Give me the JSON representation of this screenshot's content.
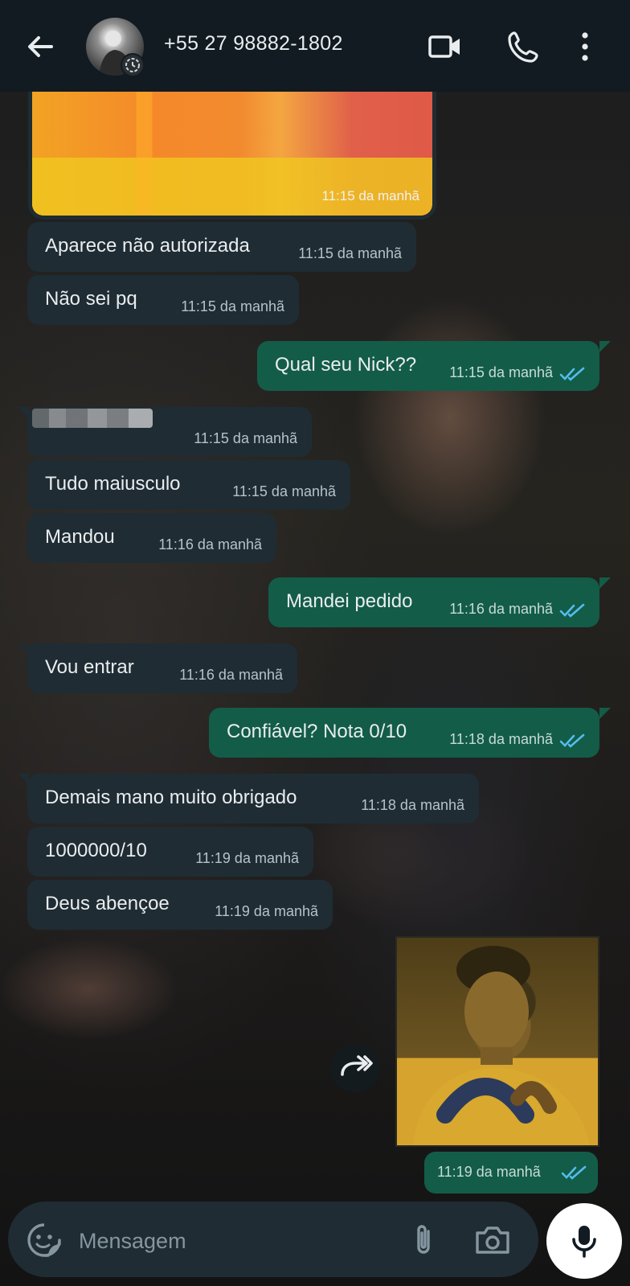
{
  "header": {
    "contact_name": "+55 27 98882-1802",
    "icons": [
      "back-arrow-icon",
      "avatar",
      "video-call-icon",
      "phone-call-icon",
      "more-options-icon"
    ]
  },
  "messages": [
    {
      "direction": "in",
      "type": "image",
      "time": "11:15 da manhã"
    },
    {
      "direction": "in",
      "text": "Aparece não autorizada",
      "time": "11:15 da manhã"
    },
    {
      "direction": "in",
      "text": "Não sei pq",
      "time": "11:15 da manhã"
    },
    {
      "direction": "out",
      "text": "Qual seu Nick??",
      "time": "11:15 da manhã",
      "status": "read"
    },
    {
      "direction": "in",
      "text": "",
      "time": "11:15 da manhã",
      "redacted": true
    },
    {
      "direction": "in",
      "text": "Tudo maiusculo",
      "time": "11:15 da manhã"
    },
    {
      "direction": "in",
      "text": "Mandou",
      "time": "11:16 da manhã"
    },
    {
      "direction": "out",
      "text": "Mandei pedido",
      "time": "11:16 da manhã",
      "status": "read"
    },
    {
      "direction": "in",
      "text": "Vou entrar",
      "time": "11:16 da manhã"
    },
    {
      "direction": "out",
      "text": "Confiável? Nota 0/10",
      "time": "11:18 da manhã",
      "status": "read"
    },
    {
      "direction": "in",
      "text": "Demais mano muito obrigado",
      "time": "11:18 da manhã"
    },
    {
      "direction": "in",
      "text": "1000000/10",
      "time": "11:19 da manhã"
    },
    {
      "direction": "in",
      "text": "Deus abençoe",
      "time": "11:19 da manhã"
    },
    {
      "direction": "out",
      "type": "image",
      "time": "11:19 da manhã",
      "status": "read"
    }
  ],
  "composer": {
    "placeholder": "Mensagem"
  },
  "colors": {
    "header_bg": "#111b21",
    "incoming_bubble": "#1f2c33",
    "outgoing_bubble": "#135c48",
    "read_ticks": "#53bdeb"
  }
}
